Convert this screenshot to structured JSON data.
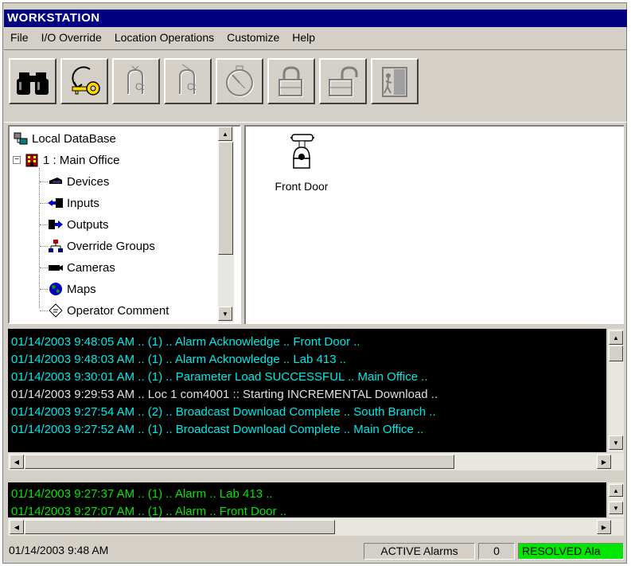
{
  "window": {
    "title": "WORKSTATION"
  },
  "menu": [
    "File",
    "I/O Override",
    "Location Operations",
    "Customize",
    "Help"
  ],
  "toolbar": {
    "buttons": [
      {
        "icon": "binoculars-icon",
        "enabled": true
      },
      {
        "icon": "key-acknowledge-icon",
        "enabled": true
      },
      {
        "icon": "alarm-tone-icon",
        "enabled": false
      },
      {
        "icon": "alarm-silence-icon",
        "enabled": false
      },
      {
        "icon": "stopwatch-icon",
        "enabled": false
      },
      {
        "icon": "lock-icon",
        "enabled": false
      },
      {
        "icon": "unlock-icon",
        "enabled": false
      },
      {
        "icon": "exit-door-icon",
        "enabled": false
      }
    ]
  },
  "tree": {
    "root": "Local DataBase",
    "location": "1 : Main Office",
    "children": [
      "Devices",
      "Inputs",
      "Outputs",
      "Override Groups",
      "Cameras",
      "Maps",
      "Operator Comment"
    ]
  },
  "right_pane": {
    "device_label": "Front Door"
  },
  "event_log": [
    {
      "text": "01/14/2003 9:48:05 AM .. (1) .. Alarm Acknowledge .. Front Door ..",
      "color": "#00e8e8"
    },
    {
      "text": "01/14/2003 9:48:03 AM .. (1) .. Alarm Acknowledge .. Lab 413 ..",
      "color": "#00e8e8"
    },
    {
      "text": "01/14/2003 9:30:01 AM .. (1) .. Parameter Load SUCCESSFUL .. Main Office ..",
      "color": "#00e8e8"
    },
    {
      "text": "01/14/2003 9:29:53 AM .. Loc 1  com4001 :: Starting INCREMENTAL Download ..",
      "color": "#e0e0e0"
    },
    {
      "text": "01/14/2003 9:27:54 AM .. (2) .. Broadcast Download Complete .. South Branch ..",
      "color": "#00e8e8"
    },
    {
      "text": "01/14/2003 9:27:52 AM .. (1) .. Broadcast Download Complete .. Main Office ..",
      "color": "#00e8e8"
    }
  ],
  "alarm_log": [
    {
      "text": "01/14/2003 9:27:37 AM .. (1) .. Alarm .. Lab 413 ..",
      "color": "#00e800"
    },
    {
      "text": "01/14/2003 9:27:07 AM .. (1) .. Alarm .. Front Door ..",
      "color": "#00e800"
    }
  ],
  "status": {
    "datetime": "01/14/2003 9:48 AM",
    "active_label": "ACTIVE Alarms",
    "active_count": "0",
    "resolved_label": "RESOLVED Ala"
  },
  "colors": {
    "titlebar": "#000080",
    "log_bg": "#000000",
    "resolved_bg": "#00e800"
  }
}
